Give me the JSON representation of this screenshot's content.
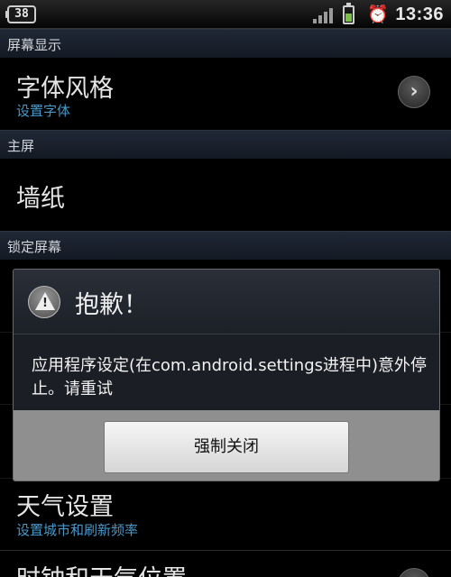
{
  "status_bar": {
    "badge": "38",
    "time": "13:36",
    "icons": [
      "signal-icon",
      "battery-icon",
      "alarm-icon"
    ]
  },
  "settings": {
    "sections": [
      {
        "label": "屏幕显示"
      },
      {
        "label": "主屏"
      },
      {
        "label": "锁定屏幕"
      }
    ],
    "items": [
      {
        "title": "字体风格",
        "subtitle": "设置字体"
      },
      {
        "title": "墙纸"
      },
      {
        "title": "天气设置",
        "subtitle": "设置城市和刷新频率"
      },
      {
        "title": "时钟和天气位置"
      }
    ]
  },
  "dialog": {
    "title": "抱歉！",
    "message": "应用程序设定(在com.android.settings进程中)意外停止。请重试",
    "button_label": "强制关闭"
  },
  "colors": {
    "subtitle": "#4a97c9",
    "section_bg": "#1a2130",
    "dialog_footer": "#8f8f8f"
  }
}
